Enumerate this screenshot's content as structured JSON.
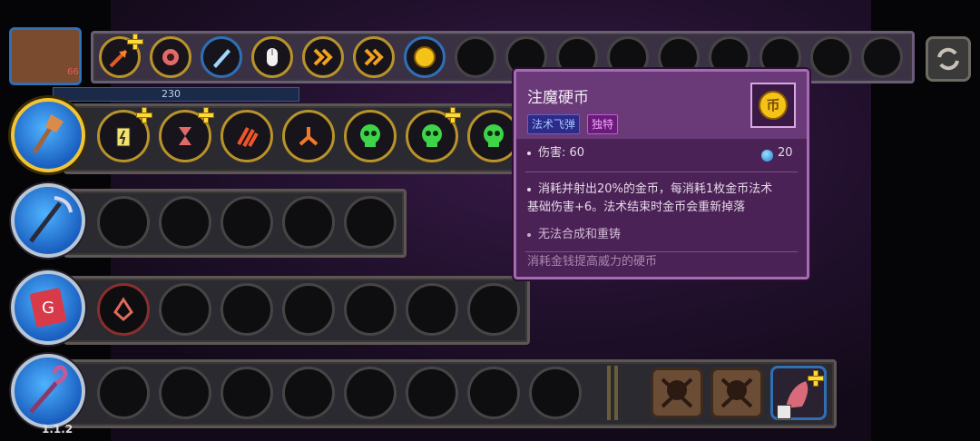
{
  "hud": {
    "mana_value": "230",
    "level_small": "66",
    "version": "1.1.2"
  },
  "tooltip": {
    "title": "注魔硬币",
    "tag_spell": "法术飞弹",
    "tag_unique": "独特",
    "damage": "伤害: 60",
    "mana_cost": "20",
    "desc_line1": "消耗并射出20%的金币，每消耗1枚金币法术",
    "desc_line2": "基础伤害+6。法术结束时金币会重新掉落",
    "bullet2": "无法合成和重铸",
    "flavor": "消耗金钱提高威力的硬币"
  },
  "colors": {
    "tooltip_bg": "#4b2255",
    "tooltip_border": "#a66bb5",
    "gold": "#f5c21a"
  }
}
